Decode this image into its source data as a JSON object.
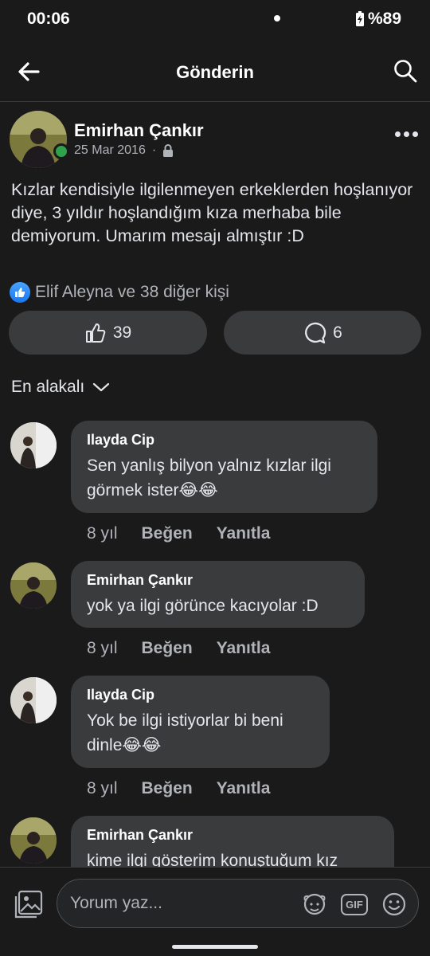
{
  "status": {
    "time": "00:06",
    "battery": "%89"
  },
  "appbar": {
    "title": "Gönderin"
  },
  "post": {
    "author": "Emirhan Çankır",
    "date": "25 Mar 2016",
    "date_sep": "·",
    "text": "Kızlar kendisiyle ilgilenmeyen erkeklerden hoşlanıyor diye, 3 yıldır hoşlandığım kıza merhaba bile demiyorum. Umarım mesajı almıştır :D",
    "reactions_text": "Elif Aleyna ve 38 diğer kişi",
    "like_count": "39",
    "comment_count": "6"
  },
  "sort_label": "En alakalı",
  "comments": [
    {
      "name": "Ilayda Cip",
      "text": "Sen yanlış bilyon yalnız kızlar ilgi görmek ister😂😂",
      "time": "8 yıl",
      "like": "Beğen",
      "reply": "Yanıtla"
    },
    {
      "name": "Emirhan Çankır",
      "text": "yok ya ilgi görünce kacıyolar :D",
      "time": "8 yıl",
      "like": "Beğen",
      "reply": "Yanıtla"
    },
    {
      "name": "Ilayda Cip",
      "text": "Yok be ilgi istiyorlar bi beni dinle😂😂",
      "time": "8 yıl",
      "like": "Beğen",
      "reply": "Yanıtla"
    },
    {
      "name": "Emirhan Çankır",
      "text": "kime ilgi gösterim konuştuğum kız"
    }
  ],
  "composer": {
    "placeholder": "Yorum yaz...",
    "gif": "GIF"
  },
  "colors": {
    "background": "#1a1a1b",
    "bubble": "#3a3b3c",
    "accent": "#1877f2",
    "online": "#31a24c"
  }
}
